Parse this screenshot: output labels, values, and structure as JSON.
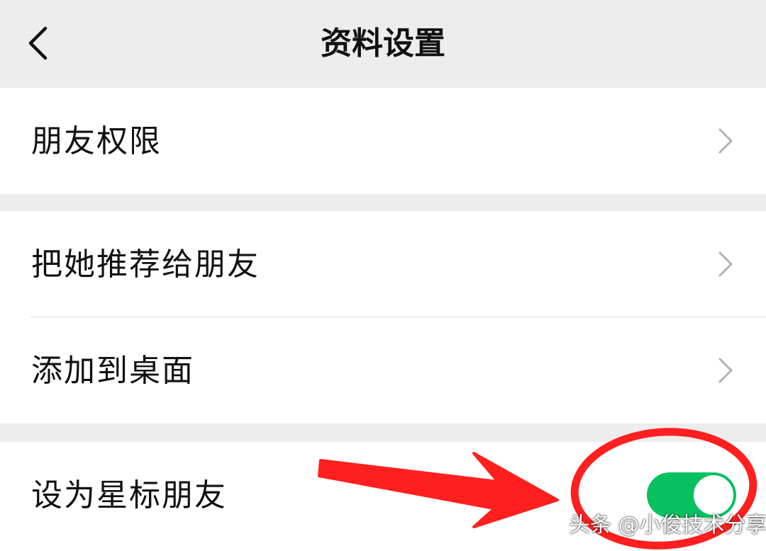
{
  "header": {
    "title": "资料设置",
    "back_icon": "chevron-left-icon"
  },
  "groups": [
    {
      "rows": [
        {
          "label": "朋友权限",
          "trailing": "chevron-right-icon"
        }
      ]
    },
    {
      "rows": [
        {
          "label": "把她推荐给朋友",
          "trailing": "chevron-right-icon"
        },
        {
          "label": "添加到桌面",
          "trailing": "chevron-right-icon"
        }
      ]
    },
    {
      "rows": [
        {
          "label": "设为星标朋友",
          "trailing": "toggle",
          "toggle_on": true
        }
      ]
    }
  ],
  "annotation": {
    "shapes": [
      "red-arrow",
      "red-ellipse-circle"
    ],
    "color": "#ff1f1f"
  },
  "watermark": "头条 @小俊技术分享",
  "colors": {
    "background": "#ededed",
    "toggle_on": "#07c160",
    "annotation_red": "#ff1f1f"
  }
}
